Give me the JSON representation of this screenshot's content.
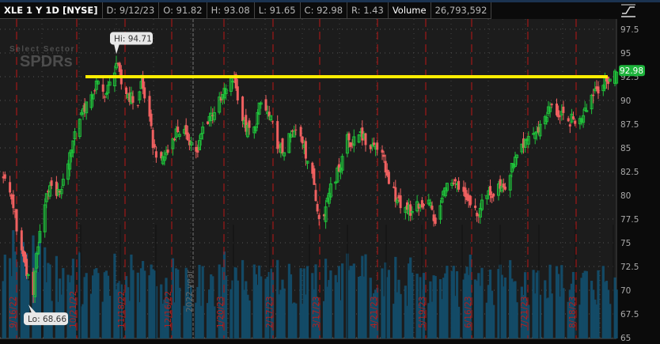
{
  "header": {
    "symbol": "XLE 1 Y 1D [NYSE]",
    "date": "D: 9/12/23",
    "open": "O: 91.82",
    "high": "H: 93.08",
    "low": "L: 91.65",
    "close": "C: 92.98",
    "range": "R: 1.43",
    "volume_label": "Volume",
    "volume_value": "26,793,592"
  },
  "toolbar": {
    "style_icon": "chart-style-icon"
  },
  "logo": {
    "line1": "Select Sector",
    "line2": "SPDRs"
  },
  "chart_data": {
    "type": "candlestick",
    "title": "XLE 1 Y 1D [NYSE]",
    "ylim": [
      65,
      97.5
    ],
    "y_ticks": [
      "65",
      "67.5",
      "70",
      "72.5",
      "75",
      "77.5",
      "80",
      "82.5",
      "85",
      "87.5",
      "90",
      "92.5",
      "95",
      "97.5"
    ],
    "x_tick_labels": [
      "9/16/22",
      "10/21/22",
      "11/18/22",
      "12/16/22",
      "2022 year",
      "1/20/23",
      "2/17/23",
      "3/17/23",
      "4/21/23",
      "5/19/23",
      "6/16/23",
      "7/21/23",
      "8/18/23"
    ],
    "grid": true,
    "annotations": {
      "high_label": "Hi: 94.71",
      "low_label": "Lo: 68.66",
      "last_price": "92.98",
      "horizontal_line_price": 92.5
    },
    "high": {
      "date": "2022-11-15",
      "value": 94.71
    },
    "low": {
      "date": "2022-09-26",
      "value": 68.66
    },
    "approx_closes": [
      [
        "2022-09-08",
        81.8
      ],
      [
        "2022-09-12",
        80.3
      ],
      [
        "2022-09-15",
        78.3
      ],
      [
        "2022-09-16",
        76.2
      ],
      [
        "2022-09-26",
        69.5
      ],
      [
        "2022-09-27",
        72
      ],
      [
        "2022-09-30",
        76.2
      ],
      [
        "2022-10-03",
        79
      ],
      [
        "2022-10-07",
        81
      ],
      [
        "2022-10-12",
        80.3
      ],
      [
        "2022-10-14",
        81.7
      ],
      [
        "2022-10-18",
        84.5
      ],
      [
        "2022-10-21",
        86.7
      ],
      [
        "2022-10-25",
        88.7
      ],
      [
        "2022-10-31",
        90.6
      ],
      [
        "2022-11-04",
        92
      ],
      [
        "2022-11-08",
        90.3
      ],
      [
        "2022-11-14",
        92.9
      ],
      [
        "2022-11-15",
        93.9
      ],
      [
        "2022-11-18",
        91.7
      ],
      [
        "2022-11-22",
        90.6
      ],
      [
        "2022-11-28",
        89.5
      ],
      [
        "2022-11-30",
        92
      ],
      [
        "2022-12-05",
        88.3
      ],
      [
        "2022-12-07",
        85
      ],
      [
        "2022-12-12",
        83.9
      ],
      [
        "2022-12-16",
        84.5
      ],
      [
        "2022-12-21",
        87
      ],
      [
        "2022-12-27",
        86.4
      ],
      [
        "2023-01-03",
        84.5
      ],
      [
        "2023-01-06",
        87.2
      ],
      [
        "2023-01-10",
        88.3
      ],
      [
        "2023-01-17",
        90
      ],
      [
        "2023-01-20",
        91.2
      ],
      [
        "2023-01-25",
        92.3
      ],
      [
        "2023-01-27",
        90
      ],
      [
        "2023-02-01",
        86.7
      ],
      [
        "2023-02-06",
        87.2
      ],
      [
        "2023-02-10",
        89.75
      ],
      [
        "2023-02-15",
        88.3
      ],
      [
        "2023-02-21",
        85
      ],
      [
        "2023-02-24",
        84.5
      ],
      [
        "2023-03-01",
        86.7
      ],
      [
        "2023-03-06",
        86.2
      ],
      [
        "2023-03-08",
        85.3
      ],
      [
        "2023-03-10",
        83.6
      ],
      [
        "2023-03-14",
        81.1
      ],
      [
        "2023-03-16",
        78.3
      ],
      [
        "2023-03-20",
        77.8
      ],
      [
        "2023-03-22",
        79.7
      ],
      [
        "2023-03-24",
        81.2
      ],
      [
        "2023-03-29",
        82.5
      ],
      [
        "2023-04-03",
        86.4
      ],
      [
        "2023-04-06",
        85.3
      ],
      [
        "2023-04-11",
        86.7
      ],
      [
        "2023-04-14",
        85.3
      ],
      [
        "2023-04-19",
        85.3
      ],
      [
        "2023-04-24",
        84.5
      ],
      [
        "2023-04-28",
        81.2
      ],
      [
        "2023-05-03",
        79.5
      ],
      [
        "2023-05-08",
        78.7
      ],
      [
        "2023-05-12",
        78.3
      ],
      [
        "2023-05-17",
        79
      ],
      [
        "2023-05-22",
        79.5
      ],
      [
        "2023-05-26",
        77
      ],
      [
        "2023-06-01",
        80.8
      ],
      [
        "2023-06-06",
        81.2
      ],
      [
        "2023-06-09",
        80.6
      ],
      [
        "2023-06-14",
        79.5
      ],
      [
        "2023-06-20",
        77.8
      ],
      [
        "2023-06-23",
        79.5
      ],
      [
        "2023-06-28",
        80
      ],
      [
        "2023-07-03",
        81.2
      ],
      [
        "2023-07-07",
        80.6
      ],
      [
        "2023-07-12",
        83.3
      ],
      [
        "2023-07-18",
        85
      ],
      [
        "2023-07-21",
        86.2
      ],
      [
        "2023-07-26",
        86.7
      ],
      [
        "2023-07-31",
        88.3
      ],
      [
        "2023-08-04",
        89.5
      ],
      [
        "2023-08-09",
        88.3
      ],
      [
        "2023-08-14",
        87.8
      ],
      [
        "2023-08-21",
        88.1
      ],
      [
        "2023-08-24",
        89.2
      ],
      [
        "2023-08-30",
        91.2
      ],
      [
        "2023-09-06",
        92
      ],
      [
        "2023-09-12",
        92.98
      ]
    ],
    "last_bar": {
      "date": "2023-09-12",
      "open": 91.82,
      "high": 93.08,
      "low": 91.65,
      "close": 92.98,
      "volume": 26793592
    }
  },
  "colors": {
    "up": "#1fc23a",
    "down": "#f06060",
    "volume": "#134a66",
    "hline": "#ffee00",
    "last_tag": "#1db33b",
    "month_marker": "#a01818"
  }
}
